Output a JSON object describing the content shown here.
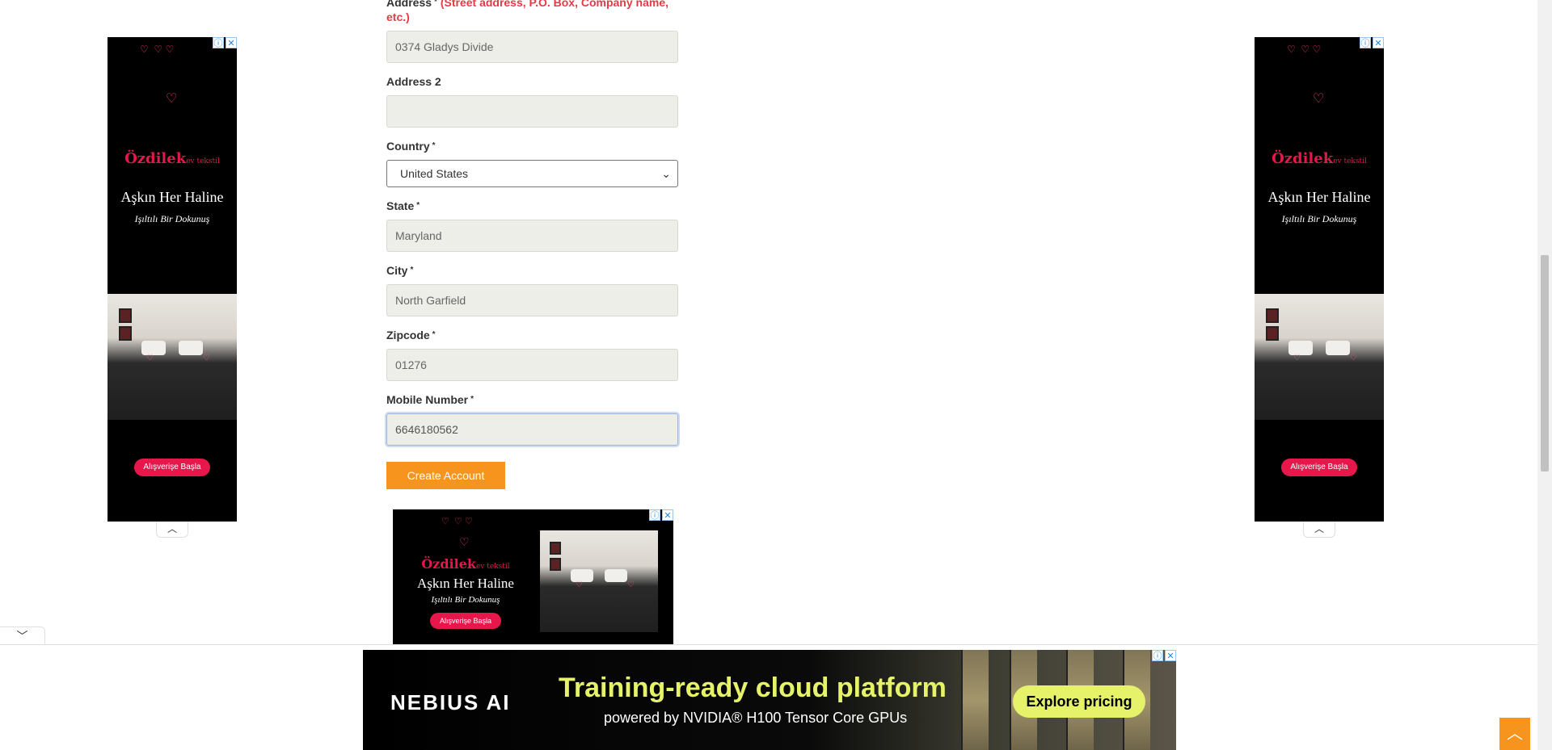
{
  "form": {
    "address_label": "Address",
    "address_hint": "(Street address, P.O. Box, Company name, etc.)",
    "address_value": "0374 Gladys Divide",
    "address2_label": "Address 2",
    "address2_value": "",
    "country_label": "Country",
    "country_value": "United States",
    "state_label": "State",
    "state_value": "Maryland",
    "city_label": "City",
    "city_value": "North Garfield",
    "zipcode_label": "Zipcode",
    "zipcode_value": "01276",
    "mobile_label": "Mobile Number",
    "mobile_value": "6646180562",
    "required_mark": "*",
    "submit_label": "Create Account"
  },
  "ads": {
    "side_brand": "Özdilek",
    "side_brand_suffix": "ev tekstil",
    "side_title": "Aşkın Her Haline",
    "side_subtitle": "Işıltılı Bir Dokunuş",
    "side_cta": "Alışverişe Başla",
    "info_icon": "ⓘ",
    "close_icon": "✕",
    "banner_logo": "NEBIUS AI",
    "banner_headline": "Training-ready cloud platform",
    "banner_sub": "powered by NVIDIA® H100 Tensor Core GPUs",
    "banner_cta": "Explore pricing"
  },
  "icons": {
    "chevron_up": "︿",
    "chevron_down": "﹀",
    "select_arrow": "⌄",
    "scroll_top": "︿"
  },
  "colors": {
    "accent": "#f7941d",
    "hint_red": "#e63946",
    "field_bg": "#eeeee8",
    "banner_lime": "#e5f26a"
  }
}
